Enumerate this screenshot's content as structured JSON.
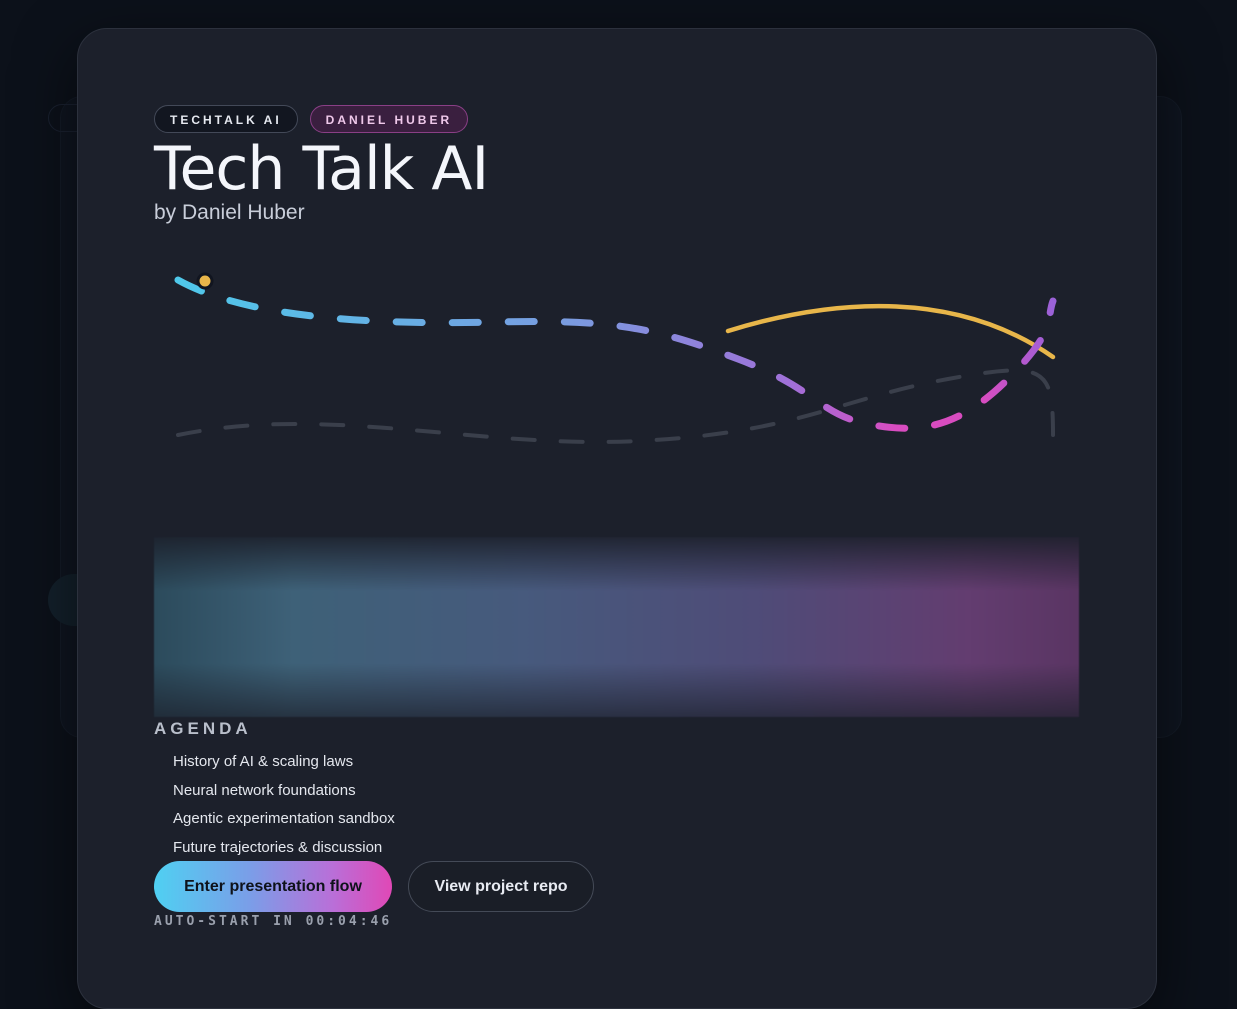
{
  "modal": {
    "badges": {
      "org": "TECHTALK AI",
      "author": "DANIEL HUBER"
    },
    "title": "Tech Talk AI",
    "subtitle": "by Daniel Huber",
    "agenda": {
      "label": "AGENDA",
      "items": [
        "History of AI & scaling laws",
        "Neural network foundations",
        "Agentic experimentation sandbox",
        "Future trajectories & discussion"
      ]
    },
    "actions": {
      "primary_label": "Enter presentation flow",
      "secondary_label": "View project repo"
    },
    "autostart": "AUTO-START IN 00:04:46"
  },
  "colors": {
    "accent_cyan": "#4fd0f2",
    "accent_magenta": "#e048b6",
    "accent_gold": "#e8b64a",
    "modal_bg": "#1c202b"
  }
}
